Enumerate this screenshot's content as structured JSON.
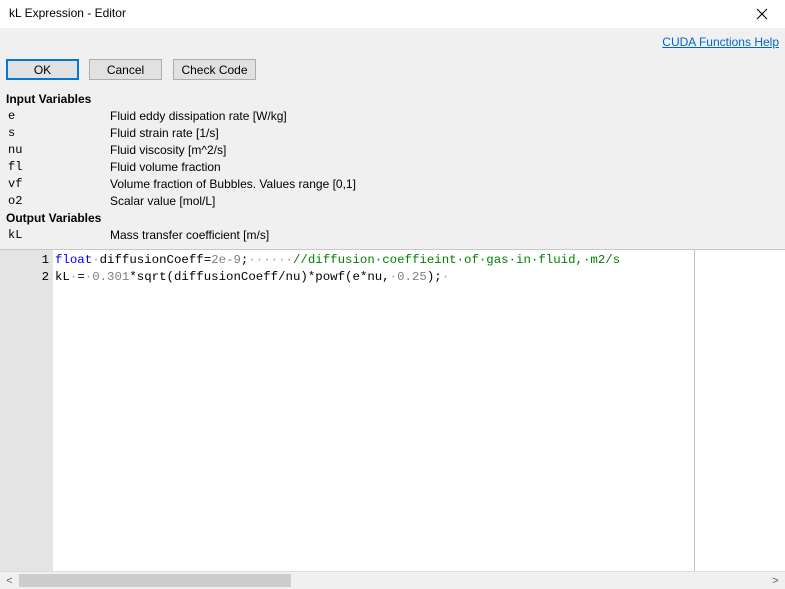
{
  "window": {
    "title": "kL Expression - Editor",
    "close_glyph": "✕"
  },
  "links": {
    "help": "CUDA Functions Help"
  },
  "buttons": {
    "ok": "OK",
    "cancel": "Cancel",
    "check": "Check Code"
  },
  "input_section": {
    "title": "Input Variables",
    "vars": [
      {
        "name": "e",
        "desc": "Fluid eddy dissipation rate [W/kg]"
      },
      {
        "name": "s",
        "desc": "Fluid strain rate [1/s]"
      },
      {
        "name": "nu",
        "desc": "Fluid viscosity [m^2/s]"
      },
      {
        "name": "fl",
        "desc": "Fluid volume fraction"
      },
      {
        "name": "vf",
        "desc": "Volume fraction of Bubbles. Values range [0,1]"
      },
      {
        "name": "o2",
        "desc": "Scalar value [mol/L]"
      }
    ]
  },
  "output_section": {
    "title": "Output Variables",
    "vars": [
      {
        "name": "kL",
        "desc": "Mass transfer coefficient [m/s]"
      }
    ]
  },
  "editor": {
    "line_numbers": [
      "1",
      "2"
    ],
    "line1": {
      "kw": "float",
      "s1": "·",
      "t1": "diffusionCoeff=",
      "n1": "2e-9",
      "t2": ";",
      "s2": "······",
      "comment": "//diffusion·coeffieint·of·gas·in·fluid,·m2/s"
    },
    "line2": {
      "t1": "kL",
      "s1": "·",
      "t2": "=",
      "s2": "·",
      "n1": "0.301",
      "t3": "*sqrt(diffusionCoeff/nu)*powf(e*nu,",
      "s3": "·",
      "n2": "0.25",
      "t4": ");",
      "s4": "·"
    }
  },
  "scrollbar": {
    "left_arrow": "<",
    "right_arrow": ">"
  },
  "colors": {
    "keyword": "#0000ff",
    "comment": "#008000",
    "number": "#808080",
    "link": "#0066cc",
    "gutter": "#e4e4e4"
  }
}
